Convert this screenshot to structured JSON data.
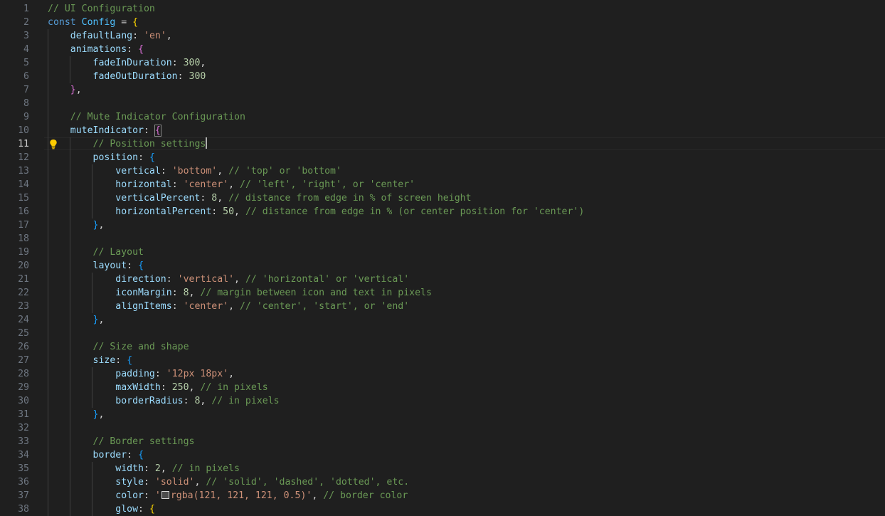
{
  "editor": {
    "current_line": 11,
    "lines": [
      {
        "n": "1",
        "indent": 0,
        "t": [
          [
            "cm",
            "// UI Configuration"
          ]
        ]
      },
      {
        "n": "2",
        "indent": 0,
        "t": [
          [
            "kw",
            "const "
          ],
          [
            "var",
            "Config"
          ],
          [
            "p",
            " = "
          ],
          [
            "b1",
            "{"
          ]
        ]
      },
      {
        "n": "3",
        "indent": 1,
        "t": [
          [
            "prop",
            "defaultLang"
          ],
          [
            "p",
            ": "
          ],
          [
            "str",
            "'en'"
          ],
          [
            "p",
            ","
          ]
        ]
      },
      {
        "n": "4",
        "indent": 1,
        "t": [
          [
            "prop",
            "animations"
          ],
          [
            "p",
            ": "
          ],
          [
            "b2",
            "{"
          ]
        ]
      },
      {
        "n": "5",
        "indent": 2,
        "t": [
          [
            "prop",
            "fadeInDuration"
          ],
          [
            "p",
            ": "
          ],
          [
            "num",
            "300"
          ],
          [
            "p",
            ","
          ]
        ]
      },
      {
        "n": "6",
        "indent": 2,
        "t": [
          [
            "prop",
            "fadeOutDuration"
          ],
          [
            "p",
            ": "
          ],
          [
            "num",
            "300"
          ]
        ]
      },
      {
        "n": "7",
        "indent": 1,
        "t": [
          [
            "b2",
            "}"
          ],
          [
            "p",
            ","
          ]
        ]
      },
      {
        "n": "8",
        "indent": 1,
        "t": []
      },
      {
        "n": "9",
        "indent": 1,
        "t": [
          [
            "cm",
            "// Mute Indicator Configuration"
          ]
        ]
      },
      {
        "n": "10",
        "indent": 1,
        "t": [
          [
            "prop",
            "muteIndicator"
          ],
          [
            "p",
            ": "
          ],
          [
            "b2hl",
            "{"
          ]
        ]
      },
      {
        "n": "11",
        "indent": 2,
        "t": [
          [
            "cm",
            "// Position settings"
          ],
          [
            "cursor",
            ""
          ]
        ]
      },
      {
        "n": "12",
        "indent": 2,
        "t": [
          [
            "prop",
            "position"
          ],
          [
            "p",
            ": "
          ],
          [
            "b3",
            "{"
          ]
        ]
      },
      {
        "n": "13",
        "indent": 3,
        "t": [
          [
            "prop",
            "vertical"
          ],
          [
            "p",
            ": "
          ],
          [
            "str",
            "'bottom'"
          ],
          [
            "p",
            ", "
          ],
          [
            "cm",
            "// 'top' or 'bottom'"
          ]
        ]
      },
      {
        "n": "14",
        "indent": 3,
        "t": [
          [
            "prop",
            "horizontal"
          ],
          [
            "p",
            ": "
          ],
          [
            "str",
            "'center'"
          ],
          [
            "p",
            ", "
          ],
          [
            "cm",
            "// 'left', 'right', or 'center'"
          ]
        ]
      },
      {
        "n": "15",
        "indent": 3,
        "t": [
          [
            "prop",
            "verticalPercent"
          ],
          [
            "p",
            ": "
          ],
          [
            "num",
            "8"
          ],
          [
            "p",
            ", "
          ],
          [
            "cm",
            "// distance from edge in % of screen height"
          ]
        ]
      },
      {
        "n": "16",
        "indent": 3,
        "t": [
          [
            "prop",
            "horizontalPercent"
          ],
          [
            "p",
            ": "
          ],
          [
            "num",
            "50"
          ],
          [
            "p",
            ", "
          ],
          [
            "cm",
            "// distance from edge in % (or center position for 'center')"
          ]
        ]
      },
      {
        "n": "17",
        "indent": 2,
        "t": [
          [
            "b3",
            "}"
          ],
          [
            "p",
            ","
          ]
        ]
      },
      {
        "n": "18",
        "indent": 2,
        "t": []
      },
      {
        "n": "19",
        "indent": 2,
        "t": [
          [
            "cm",
            "// Layout"
          ]
        ]
      },
      {
        "n": "20",
        "indent": 2,
        "t": [
          [
            "prop",
            "layout"
          ],
          [
            "p",
            ": "
          ],
          [
            "b3",
            "{"
          ]
        ]
      },
      {
        "n": "21",
        "indent": 3,
        "t": [
          [
            "prop",
            "direction"
          ],
          [
            "p",
            ": "
          ],
          [
            "str",
            "'vertical'"
          ],
          [
            "p",
            ", "
          ],
          [
            "cm",
            "// 'horizontal' or 'vertical'"
          ]
        ]
      },
      {
        "n": "22",
        "indent": 3,
        "t": [
          [
            "prop",
            "iconMargin"
          ],
          [
            "p",
            ": "
          ],
          [
            "num",
            "8"
          ],
          [
            "p",
            ", "
          ],
          [
            "cm",
            "// margin between icon and text in pixels"
          ]
        ]
      },
      {
        "n": "23",
        "indent": 3,
        "t": [
          [
            "prop",
            "alignItems"
          ],
          [
            "p",
            ": "
          ],
          [
            "str",
            "'center'"
          ],
          [
            "p",
            ", "
          ],
          [
            "cm",
            "// 'center', 'start', or 'end'"
          ]
        ]
      },
      {
        "n": "24",
        "indent": 2,
        "t": [
          [
            "b3",
            "}"
          ],
          [
            "p",
            ","
          ]
        ]
      },
      {
        "n": "25",
        "indent": 2,
        "t": []
      },
      {
        "n": "26",
        "indent": 2,
        "t": [
          [
            "cm",
            "// Size and shape"
          ]
        ]
      },
      {
        "n": "27",
        "indent": 2,
        "t": [
          [
            "prop",
            "size"
          ],
          [
            "p",
            ": "
          ],
          [
            "b3",
            "{"
          ]
        ]
      },
      {
        "n": "28",
        "indent": 3,
        "t": [
          [
            "prop",
            "padding"
          ],
          [
            "p",
            ": "
          ],
          [
            "str",
            "'12px 18px'"
          ],
          [
            "p",
            ","
          ]
        ]
      },
      {
        "n": "29",
        "indent": 3,
        "t": [
          [
            "prop",
            "maxWidth"
          ],
          [
            "p",
            ": "
          ],
          [
            "num",
            "250"
          ],
          [
            "p",
            ", "
          ],
          [
            "cm",
            "// in pixels"
          ]
        ]
      },
      {
        "n": "30",
        "indent": 3,
        "t": [
          [
            "prop",
            "borderRadius"
          ],
          [
            "p",
            ": "
          ],
          [
            "num",
            "8"
          ],
          [
            "p",
            ", "
          ],
          [
            "cm",
            "// in pixels"
          ]
        ]
      },
      {
        "n": "31",
        "indent": 2,
        "t": [
          [
            "b3",
            "}"
          ],
          [
            "p",
            ","
          ]
        ]
      },
      {
        "n": "32",
        "indent": 2,
        "t": []
      },
      {
        "n": "33",
        "indent": 2,
        "t": [
          [
            "cm",
            "// Border settings"
          ]
        ]
      },
      {
        "n": "34",
        "indent": 2,
        "t": [
          [
            "prop",
            "border"
          ],
          [
            "p",
            ": "
          ],
          [
            "b3",
            "{"
          ]
        ]
      },
      {
        "n": "35",
        "indent": 3,
        "t": [
          [
            "prop",
            "width"
          ],
          [
            "p",
            ": "
          ],
          [
            "num",
            "2"
          ],
          [
            "p",
            ", "
          ],
          [
            "cm",
            "// in pixels"
          ]
        ]
      },
      {
        "n": "36",
        "indent": 3,
        "t": [
          [
            "prop",
            "style"
          ],
          [
            "p",
            ": "
          ],
          [
            "str",
            "'solid'"
          ],
          [
            "p",
            ", "
          ],
          [
            "cm",
            "// 'solid', 'dashed', 'dotted', etc."
          ]
        ]
      },
      {
        "n": "37",
        "indent": 3,
        "t": [
          [
            "prop",
            "color"
          ],
          [
            "p",
            ": "
          ],
          [
            "str",
            "'"
          ],
          [
            "swatch",
            ""
          ],
          [
            "str",
            "rgba(121, 121, 121, 0.5)'"
          ],
          [
            "p",
            ", "
          ],
          [
            "cm",
            "// border color"
          ]
        ]
      },
      {
        "n": "38",
        "indent": 3,
        "t": [
          [
            "prop",
            "glow"
          ],
          [
            "p",
            ": "
          ],
          [
            "b1",
            "{"
          ]
        ]
      }
    ]
  }
}
